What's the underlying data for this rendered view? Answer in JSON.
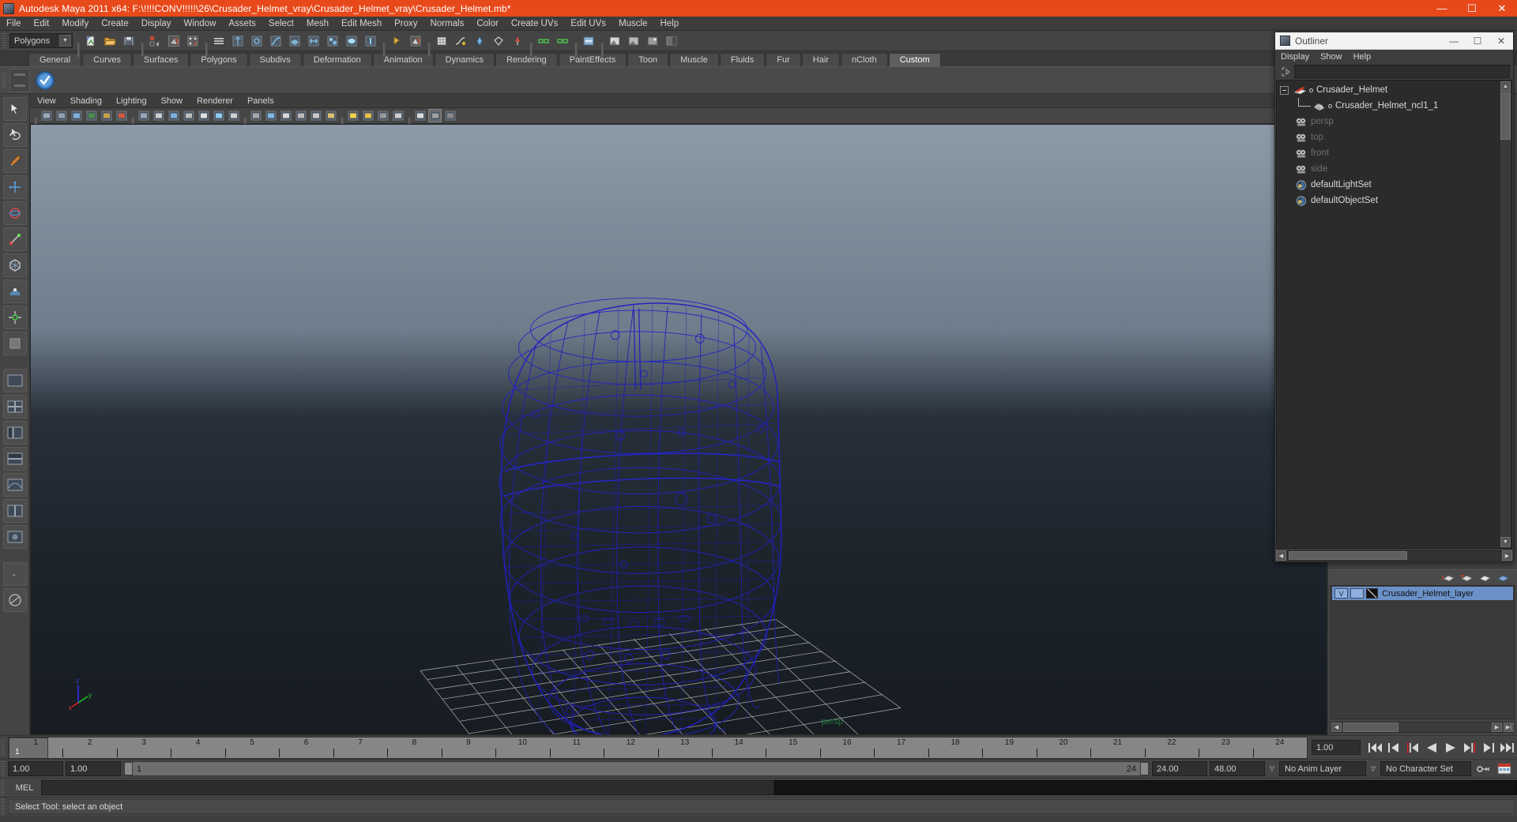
{
  "window": {
    "title": "Autodesk Maya 2011 x64: F:\\!!!!CONV!!!!!\\26\\Crusader_Helmet_vray\\Crusader_Helmet_vray\\Crusader_Helmet.mb*",
    "minimize": "—",
    "maximize": "☐",
    "close": "✕",
    "accent_color": "#e8491b"
  },
  "menubar": {
    "items": [
      {
        "label": "File"
      },
      {
        "label": "Edit"
      },
      {
        "label": "Modify"
      },
      {
        "label": "Create"
      },
      {
        "label": "Display"
      },
      {
        "label": "Window"
      },
      {
        "label": "Assets"
      },
      {
        "label": "Select"
      },
      {
        "label": "Mesh"
      },
      {
        "label": "Edit Mesh"
      },
      {
        "label": "Proxy"
      },
      {
        "label": "Normals"
      },
      {
        "label": "Color"
      },
      {
        "label": "Create UVs"
      },
      {
        "label": "Edit UVs"
      },
      {
        "label": "Muscle"
      },
      {
        "label": "Help"
      }
    ]
  },
  "statusline": {
    "mode_selector": {
      "value": "Polygons",
      "caret": "▼"
    },
    "buttons": [
      {
        "name": "new-scene-button"
      },
      {
        "name": "open-scene-button"
      },
      {
        "name": "save-scene-button"
      },
      {
        "name": "undo-button"
      },
      {
        "name": "redo-button"
      },
      {
        "name": "select-by-hierarchy-button"
      },
      {
        "name": "select-by-object-button"
      },
      {
        "name": "select-by-component-button"
      },
      {
        "name": "select-mask-list-button"
      },
      {
        "name": "handle-mask-button"
      },
      {
        "name": "joint-mask-button"
      },
      {
        "name": "curve-mask-button"
      },
      {
        "name": "surface-mask-button"
      },
      {
        "name": "deformation-mask-button"
      },
      {
        "name": "dynamic-mask-button"
      },
      {
        "name": "rendering-mask-button"
      },
      {
        "name": "misc-mask-button"
      },
      {
        "name": "lock-selection-button"
      },
      {
        "name": "highlight-selection-button"
      },
      {
        "name": "snap-grid-button"
      },
      {
        "name": "snap-curve-button"
      },
      {
        "name": "snap-point-button"
      },
      {
        "name": "snap-view-plane-button"
      },
      {
        "name": "snap-live-button"
      },
      {
        "name": "input-connection-button"
      },
      {
        "name": "output-connection-button"
      },
      {
        "name": "construction-history-button"
      },
      {
        "name": "render-current-frame-button"
      },
      {
        "name": "ipr-render-button"
      },
      {
        "name": "render-settings-button"
      },
      {
        "name": "toggle-sidebar-button"
      }
    ]
  },
  "shelf": {
    "tabs": [
      {
        "label": "General",
        "active": false
      },
      {
        "label": "Curves",
        "active": false
      },
      {
        "label": "Surfaces",
        "active": false
      },
      {
        "label": "Polygons",
        "active": false
      },
      {
        "label": "Subdivs",
        "active": false
      },
      {
        "label": "Deformation",
        "active": false
      },
      {
        "label": "Animation",
        "active": false
      },
      {
        "label": "Dynamics",
        "active": false
      },
      {
        "label": "Rendering",
        "active": false
      },
      {
        "label": "PaintEffects",
        "active": false
      },
      {
        "label": "Toon",
        "active": false
      },
      {
        "label": "Muscle",
        "active": false
      },
      {
        "label": "Fluids",
        "active": false
      },
      {
        "label": "Fur",
        "active": false
      },
      {
        "label": "Hair",
        "active": false
      },
      {
        "label": "nCloth",
        "active": false
      },
      {
        "label": "Custom",
        "active": true
      }
    ],
    "items": [
      {
        "name": "custom-shelf-check-icon"
      }
    ]
  },
  "toolbox": {
    "tools": [
      {
        "name": "select-tool"
      },
      {
        "name": "lasso-select-tool"
      },
      {
        "name": "paint-select-tool"
      },
      {
        "name": "move-tool"
      },
      {
        "name": "rotate-tool"
      },
      {
        "name": "scale-tool"
      },
      {
        "name": "universal-manipulator-tool"
      },
      {
        "name": "soft-modification-tool"
      },
      {
        "name": "show-manipulator-tool"
      },
      {
        "name": "last-tool-used"
      },
      {
        "name": "layout-single-perspective"
      },
      {
        "name": "layout-four-view"
      },
      {
        "name": "layout-outliner-persp"
      },
      {
        "name": "layout-hypershade-persp"
      },
      {
        "name": "layout-persp-graph"
      },
      {
        "name": "layout-dual-view"
      },
      {
        "name": "layout-persp-render"
      },
      {
        "name": "layout-more"
      },
      {
        "name": "paint-effects-toggle"
      }
    ]
  },
  "viewport": {
    "menus": [
      {
        "label": "View"
      },
      {
        "label": "Shading"
      },
      {
        "label": "Lighting"
      },
      {
        "label": "Show"
      },
      {
        "label": "Renderer"
      },
      {
        "label": "Panels"
      }
    ],
    "toolbar_buttons": [
      {
        "name": "select-camera-button"
      },
      {
        "name": "lock-camera-button"
      },
      {
        "name": "camera-attributes-button"
      },
      {
        "name": "bookmark-button"
      },
      {
        "name": "image-plane-button"
      },
      {
        "name": "two-d-pan-zoom-button"
      },
      {
        "name": "grid-toggle-button"
      },
      {
        "name": "film-gate-button"
      },
      {
        "name": "resolution-gate-button"
      },
      {
        "name": "gate-mask-button"
      },
      {
        "name": "film-gate-display-button"
      },
      {
        "name": "xray-joints-button"
      },
      {
        "name": "exposure-button"
      },
      {
        "name": "wireframe-shading-button"
      },
      {
        "name": "smooth-shade-all-button"
      },
      {
        "name": "smooth-shade-selected-button"
      },
      {
        "name": "flat-shade-button"
      },
      {
        "name": "shaded-wireframe-button"
      },
      {
        "name": "textured-button"
      },
      {
        "name": "use-default-light-button"
      },
      {
        "name": "use-all-lights-button"
      },
      {
        "name": "shadows-button"
      },
      {
        "name": "ao-button"
      },
      {
        "name": "isolate-select-button"
      },
      {
        "name": "xray-button"
      },
      {
        "name": "xray-shading-button"
      }
    ],
    "camera_label": "persp",
    "axis": {
      "x": "x",
      "y": "y",
      "z": "z"
    },
    "wireframe_color": "#1a1ab4",
    "grid_color": "#bfbfbf"
  },
  "outliner": {
    "title": "Outliner",
    "minimize": "—",
    "maximize": "☐",
    "close": "✕",
    "menus": [
      {
        "label": "Display"
      },
      {
        "label": "Show"
      },
      {
        "label": "Help"
      }
    ],
    "search_value": "",
    "search_placeholder": "",
    "tree": [
      {
        "label": "Crusader_Helmet",
        "icon": "transform-icon",
        "dim": false,
        "indent": 0,
        "expander": true,
        "dot": true
      },
      {
        "label": "Crusader_Helmet_ncl1_1",
        "icon": "mesh-icon",
        "dim": false,
        "indent": 1,
        "expander": false,
        "dot": true
      },
      {
        "label": "persp",
        "icon": "camera-icon",
        "dim": true,
        "indent": 1,
        "expander": false,
        "dot": false
      },
      {
        "label": "top",
        "icon": "camera-icon",
        "dim": true,
        "indent": 1,
        "expander": false,
        "dot": false
      },
      {
        "label": "front",
        "icon": "camera-icon",
        "dim": true,
        "indent": 1,
        "expander": false,
        "dot": false
      },
      {
        "label": "side",
        "icon": "camera-icon",
        "dim": true,
        "indent": 1,
        "expander": false,
        "dot": false
      },
      {
        "label": "defaultLightSet",
        "icon": "set-icon",
        "dim": false,
        "indent": 1,
        "expander": false,
        "dot": false
      },
      {
        "label": "defaultObjectSet",
        "icon": "set-icon",
        "dim": false,
        "indent": 1,
        "expander": false,
        "dot": false
      }
    ]
  },
  "layer_editor": {
    "layers": [
      {
        "visibility": "V",
        "mode": "",
        "name": "Crusader_Helmet_layer"
      }
    ],
    "tools": [
      {
        "name": "new-layer-button"
      },
      {
        "name": "new-layer-from-selected-button"
      },
      {
        "name": "layer-up-button"
      },
      {
        "name": "layer-down-button"
      }
    ]
  },
  "timeslider": {
    "ticks": [
      {
        "label": "1",
        "frame": 1
      },
      {
        "label": "2",
        "frame": 2
      },
      {
        "label": "3",
        "frame": 3
      },
      {
        "label": "4",
        "frame": 4
      },
      {
        "label": "5",
        "frame": 5
      },
      {
        "label": "6",
        "frame": 6
      },
      {
        "label": "7",
        "frame": 7
      },
      {
        "label": "8",
        "frame": 8
      },
      {
        "label": "9",
        "frame": 9
      },
      {
        "label": "10",
        "frame": 10
      },
      {
        "label": "11",
        "frame": 11
      },
      {
        "label": "12",
        "frame": 12
      },
      {
        "label": "13",
        "frame": 13
      },
      {
        "label": "14",
        "frame": 14
      },
      {
        "label": "15",
        "frame": 15
      },
      {
        "label": "16",
        "frame": 16
      },
      {
        "label": "17",
        "frame": 17
      },
      {
        "label": "18",
        "frame": 18
      },
      {
        "label": "19",
        "frame": 19
      },
      {
        "label": "20",
        "frame": 20
      },
      {
        "label": "21",
        "frame": 21
      },
      {
        "label": "22",
        "frame": 22
      },
      {
        "label": "23",
        "frame": 23
      },
      {
        "label": "24",
        "frame": 24
      }
    ],
    "current_frame": "1",
    "current_time_field": "1.00",
    "playback_buttons": [
      {
        "name": "go-to-start-button",
        "glyph": "⏮"
      },
      {
        "name": "step-back-keyframe-button",
        "glyph": "⏪"
      },
      {
        "name": "step-back-frame-button",
        "glyph": "◀"
      },
      {
        "name": "play-backwards-button",
        "glyph": "◀"
      },
      {
        "name": "play-forwards-button",
        "glyph": "▶"
      },
      {
        "name": "step-forward-frame-button",
        "glyph": "▶"
      },
      {
        "name": "step-forward-keyframe-button",
        "glyph": "⏩"
      },
      {
        "name": "go-to-end-button",
        "glyph": "⏭"
      }
    ]
  },
  "rangeslider": {
    "anim_start": "1.00",
    "range_start": "1.00",
    "bar_start": "1",
    "bar_end": "24",
    "range_end": "24.00",
    "anim_end": "48.00",
    "anim_layer": "No Anim Layer",
    "character_set": "No Character Set",
    "caret": "▽",
    "buttons": [
      {
        "name": "auto-keyframe-button"
      },
      {
        "name": "animation-preferences-button"
      }
    ]
  },
  "commandline": {
    "language_label": "MEL",
    "input_value": "",
    "output_value": ""
  },
  "helpline": {
    "message": "Select Tool: select an object"
  }
}
